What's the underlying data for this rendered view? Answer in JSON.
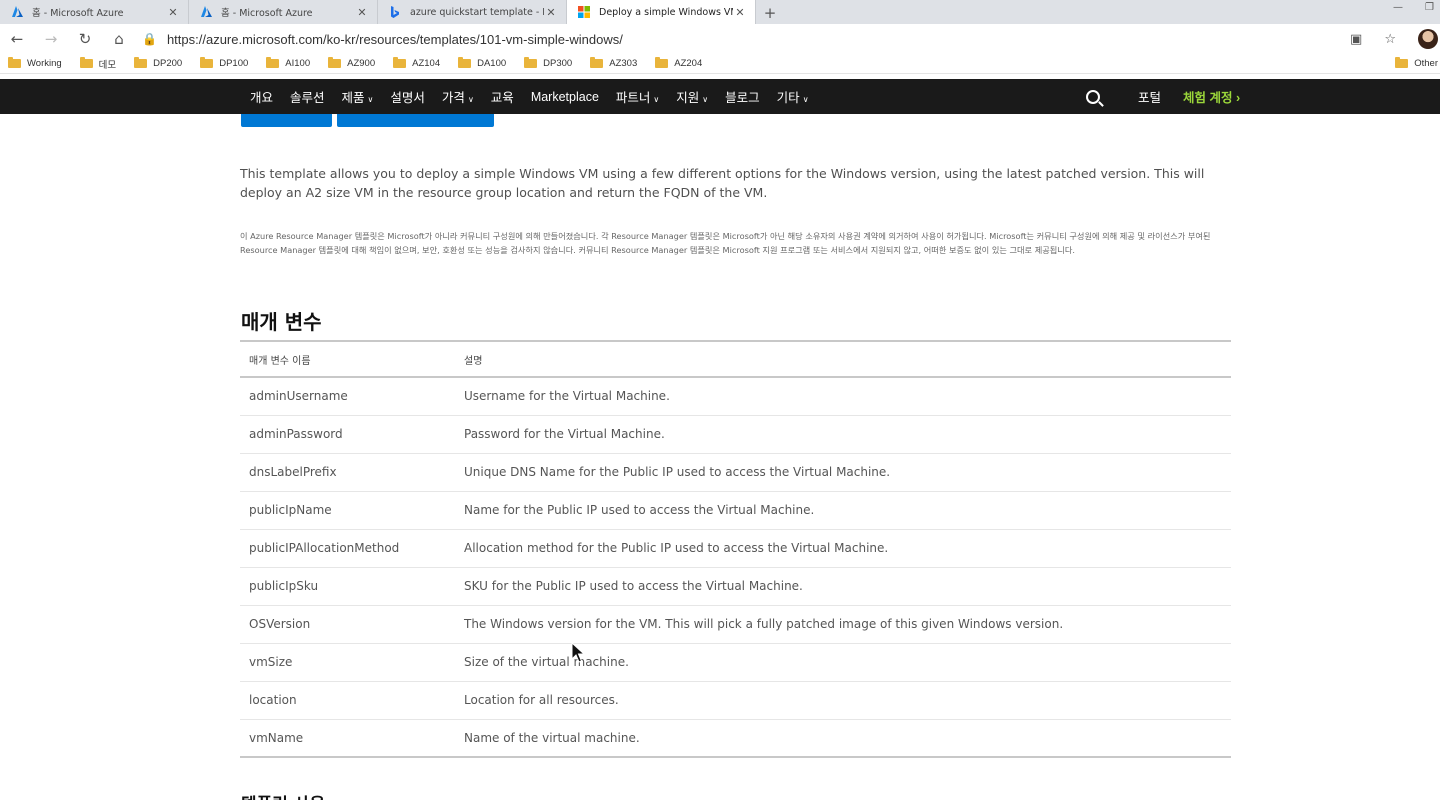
{
  "browser": {
    "tabs": [
      {
        "title": "홈 - Microsoft Azure",
        "icon": "azure-icon",
        "active": false
      },
      {
        "title": "홈 - Microsoft Azure",
        "icon": "azure-icon",
        "active": false
      },
      {
        "title": "azure quickstart template - Bing",
        "icon": "bing-icon",
        "active": false
      },
      {
        "title": "Deploy a simple Windows VM",
        "icon": "microsoft-icon",
        "active": true
      }
    ],
    "url": "https://azure.microsoft.com/ko-kr/resources/templates/101-vm-simple-windows/",
    "bookmarks": [
      "Working",
      "데모",
      "DP200",
      "DP100",
      "AI100",
      "AZ900",
      "AZ104",
      "DA100",
      "DP300",
      "AZ303",
      "AZ204"
    ],
    "other_bookmarks": "Other"
  },
  "site_nav": {
    "items": [
      {
        "label": "개요",
        "dropdown": false
      },
      {
        "label": "솔루션",
        "dropdown": false
      },
      {
        "label": "제품",
        "dropdown": true
      },
      {
        "label": "설명서",
        "dropdown": false
      },
      {
        "label": "가격",
        "dropdown": true
      },
      {
        "label": "교육",
        "dropdown": false
      },
      {
        "label": "Marketplace",
        "dropdown": false
      },
      {
        "label": "파트너",
        "dropdown": true
      },
      {
        "label": "지원",
        "dropdown": true
      },
      {
        "label": "블로그",
        "dropdown": false
      },
      {
        "label": "기타",
        "dropdown": true
      }
    ],
    "portal": "포털",
    "trial": "체험 계정"
  },
  "content": {
    "description": "This template allows you to deploy a simple Windows VM using a few different options for the Windows version, using the latest patched version. This will deploy an A2 size VM in the resource group location and return the FQDN of the VM.",
    "disclaimer": "이 Azure Resource Manager 템플릿은 Microsoft가 아니라 커뮤니티 구성원에 의해 만들어졌습니다. 각 Resource Manager 템플릿은 Microsoft가 아닌 해당 소유자의 사용권 계약에 의거하여 사용이 허가됩니다. Microsoft는 커뮤니티 구성원에 의해 제공 및 라이선스가 부여된 Resource Manager 템플릿에 대해 책임이 없으며, 보안, 호환성 또는 성능을 검사하지 않습니다. 커뮤니티 Resource Manager 템플릿은 Microsoft 지원 프로그램 또는 서비스에서 지원되지 않고, 어떠한 보증도 없이 있는 그대로 제공됩니다.",
    "params_title": "매개 변수",
    "params_headers": [
      "매개 변수 이름",
      "설명"
    ],
    "params": [
      {
        "name": "adminUsername",
        "desc": "Username for the Virtual Machine."
      },
      {
        "name": "adminPassword",
        "desc": "Password for the Virtual Machine."
      },
      {
        "name": "dnsLabelPrefix",
        "desc": "Unique DNS Name for the Public IP used to access the Virtual Machine."
      },
      {
        "name": "publicIpName",
        "desc": "Name for the Public IP used to access the Virtual Machine."
      },
      {
        "name": "publicIPAllocationMethod",
        "desc": "Allocation method for the Public IP used to access the Virtual Machine."
      },
      {
        "name": "publicIpSku",
        "desc": "SKU for the Public IP used to access the Virtual Machine."
      },
      {
        "name": "OSVersion",
        "desc": "The Windows version for the VM. This will pick a fully patched image of this given Windows version."
      },
      {
        "name": "vmSize",
        "desc": "Size of the virtual machine."
      },
      {
        "name": "location",
        "desc": "Location for all resources."
      },
      {
        "name": "vmName",
        "desc": "Name of the virtual machine."
      }
    ],
    "next_section_title": "템플릿 사용"
  },
  "colors": {
    "nav_bg": "#1a1a1a",
    "trial": "#9bd73a",
    "button": "#0078d4",
    "folder": "#e9b43b"
  }
}
